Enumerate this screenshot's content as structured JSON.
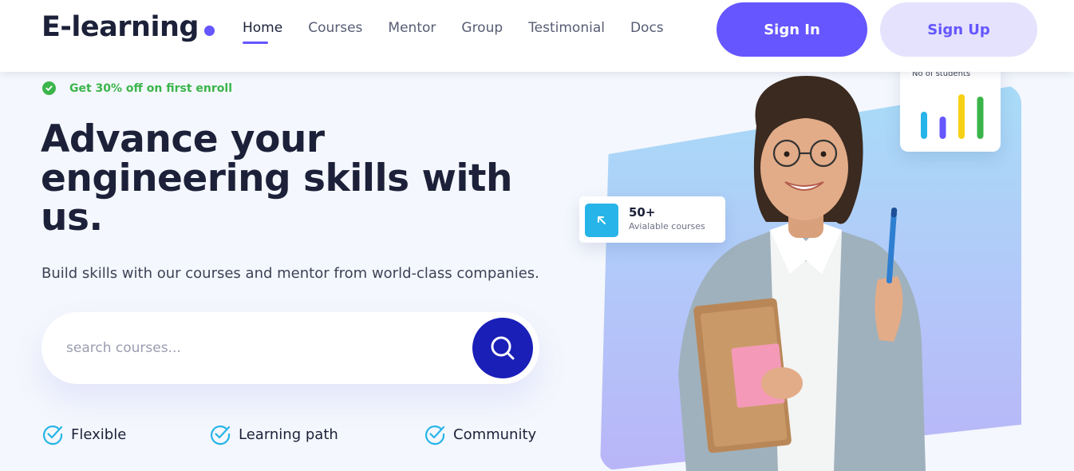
{
  "header": {
    "logo": "E-learning",
    "nav": [
      {
        "label": "Home",
        "active": true
      },
      {
        "label": "Courses",
        "active": false
      },
      {
        "label": "Mentor",
        "active": false
      },
      {
        "label": "Group",
        "active": false
      },
      {
        "label": "Testimonial",
        "active": false
      },
      {
        "label": "Docs",
        "active": false
      }
    ],
    "signin_label": "Sign In",
    "signup_label": "Sign Up"
  },
  "hero": {
    "promo_text": "Get 30% off on first enroll",
    "title": "Advance your engineering skills with us.",
    "subtitle": "Build skills with our courses and mentor from world-class companies.",
    "search": {
      "placeholder": "search courses..."
    },
    "features": [
      {
        "label": "Flexible"
      },
      {
        "label": "Learning path"
      },
      {
        "label": "Community"
      }
    ]
  },
  "stats": {
    "courses_count": "50+",
    "courses_label": "Avialable courses",
    "students_label": "No of students",
    "student_bars": [
      {
        "value": 0.55,
        "color": "#27b4e8"
      },
      {
        "value": 0.45,
        "color": "#6556ff"
      },
      {
        "value": 0.9,
        "color": "#f7d117"
      },
      {
        "value": 0.85,
        "color": "#3bb54a"
      }
    ]
  },
  "colors": {
    "accent": "#6556ff",
    "navy": "#1a1fb8",
    "green": "#3bb54a",
    "cyan": "#27b4e8"
  }
}
